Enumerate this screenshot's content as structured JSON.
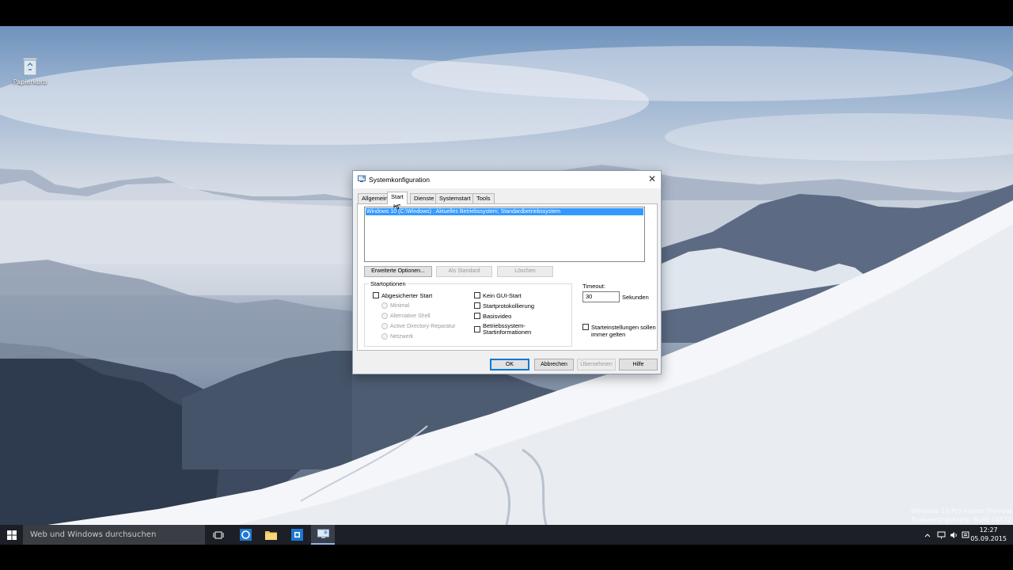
{
  "desktop": {
    "recycle_bin_label": "Papierkorb",
    "watermark_line1": "Windows 10 Pro Insider Preview",
    "watermark_line2": "Evaluierungskopie. Build 10532"
  },
  "taskbar": {
    "search_placeholder": "Web und Windows durchsuchen",
    "time": "12:27",
    "date": "05.09.2015",
    "icons": [
      "windows-start-icon",
      "task-view-icon",
      "edge-icon",
      "file-explorer-icon",
      "store-icon",
      "msconfig-icon"
    ],
    "tray_icons": [
      "chevron-up-icon",
      "network-icon",
      "volume-icon",
      "action-center-icon"
    ]
  },
  "dialog": {
    "title": "Systemkonfiguration",
    "close_label": "✕",
    "tabs": [
      {
        "label": "Allgemein",
        "active": false
      },
      {
        "label": "Start",
        "active": true
      },
      {
        "label": "Dienste",
        "active": false
      },
      {
        "label": "Systemstart",
        "active": false
      },
      {
        "label": "Tools",
        "active": false
      }
    ],
    "os_entry": "Windows 10 (C:\\Windows) : Aktuelles Betriebssystem; Standardbetriebssystem",
    "buttons": {
      "advanced": "Erweiterte Optionen...",
      "set_default": "Als Standard",
      "delete": "Löschen",
      "ok": "OK",
      "cancel": "Abbrechen",
      "apply": "Übernehmen",
      "help": "Hilfe"
    },
    "startoptions": {
      "label": "Startoptionen",
      "safe_boot": "Abgesicherter Start",
      "minimal": "Minimal",
      "alt_shell": "Alternative Shell",
      "ad_repair": "Active Directory-Reparatur",
      "network": "Netzwerk",
      "no_gui": "Kein GUI-Start",
      "boot_log": "Startprotokollierung",
      "base_video": "Basisvideo",
      "os_info_line1": "Betriebssystem-",
      "os_info_line2": "Startinformationen"
    },
    "timeout": {
      "label": "Timeout:",
      "value": "30",
      "unit": "Sekunden"
    },
    "permanent_line1": "Starteinstellungen sollen",
    "permanent_line2": "immer gelten"
  }
}
